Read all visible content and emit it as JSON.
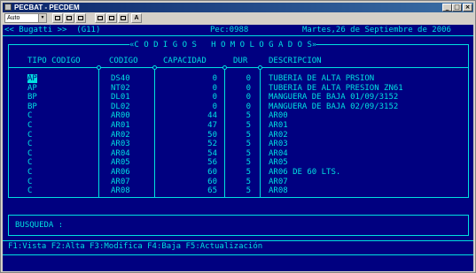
{
  "window": {
    "title": "PECBAT - PECDEM"
  },
  "toolbar": {
    "font_value": "Auto",
    "font_button_label": "A"
  },
  "status": {
    "left": "<< Bugatti >>  (G11)",
    "center": "Pec:0988",
    "right": "Martes,26 de Septiembre de 2006"
  },
  "table": {
    "title": "«C O D I G O S   H O M O L O G A D O S»",
    "headers": {
      "tipo": "TIPO CODIGO",
      "codigo": "CODIGO",
      "capacidad": "CAPACIDAD",
      "dur": "DUR",
      "descripcion": "DESCRIPCION"
    },
    "rows": [
      {
        "tipo": "AP",
        "codigo": "DS40",
        "capacidad": "0",
        "dur": "0",
        "descripcion": "TUBERIA DE ALTA PRSION"
      },
      {
        "tipo": "AP",
        "codigo": "NT02",
        "capacidad": "0",
        "dur": "0",
        "descripcion": "TUBERIA DE ALTA PRESION ZN61"
      },
      {
        "tipo": "BP",
        "codigo": "DL01",
        "capacidad": "0",
        "dur": "0",
        "descripcion": "MANGUERA DE BAJA 01/09/3152"
      },
      {
        "tipo": "BP",
        "codigo": "DL02",
        "capacidad": "0",
        "dur": "0",
        "descripcion": "MANGUERA DE BAJA 02/09/3152"
      },
      {
        "tipo": "C",
        "codigo": "AR00",
        "capacidad": "44",
        "dur": "5",
        "descripcion": "AR00"
      },
      {
        "tipo": "C",
        "codigo": "AR01",
        "capacidad": "47",
        "dur": "5",
        "descripcion": "AR01"
      },
      {
        "tipo": "C",
        "codigo": "AR02",
        "capacidad": "50",
        "dur": "5",
        "descripcion": "AR02"
      },
      {
        "tipo": "C",
        "codigo": "AR03",
        "capacidad": "52",
        "dur": "5",
        "descripcion": "AR03"
      },
      {
        "tipo": "C",
        "codigo": "AR04",
        "capacidad": "54",
        "dur": "5",
        "descripcion": "AR04"
      },
      {
        "tipo": "C",
        "codigo": "AR05",
        "capacidad": "56",
        "dur": "5",
        "descripcion": "AR05"
      },
      {
        "tipo": "C",
        "codigo": "AR06",
        "capacidad": "60",
        "dur": "5",
        "descripcion": "AR06 DE 60 LTS."
      },
      {
        "tipo": "C",
        "codigo": "AR07",
        "capacidad": "60",
        "dur": "5",
        "descripcion": "AR07"
      },
      {
        "tipo": "C",
        "codigo": "AR08",
        "capacidad": "65",
        "dur": "5",
        "descripcion": "AR08"
      }
    ]
  },
  "search": {
    "label": "BUSQUEDA :",
    "value": ""
  },
  "function_keys": "F1:Vista F2:Alta F3:Modifica F4:Baja F5:Actualización",
  "colors": {
    "background": "#000080",
    "text": "#00e0e0",
    "selected_bg": "#00e0e0",
    "title_bar": "#0a246a"
  }
}
